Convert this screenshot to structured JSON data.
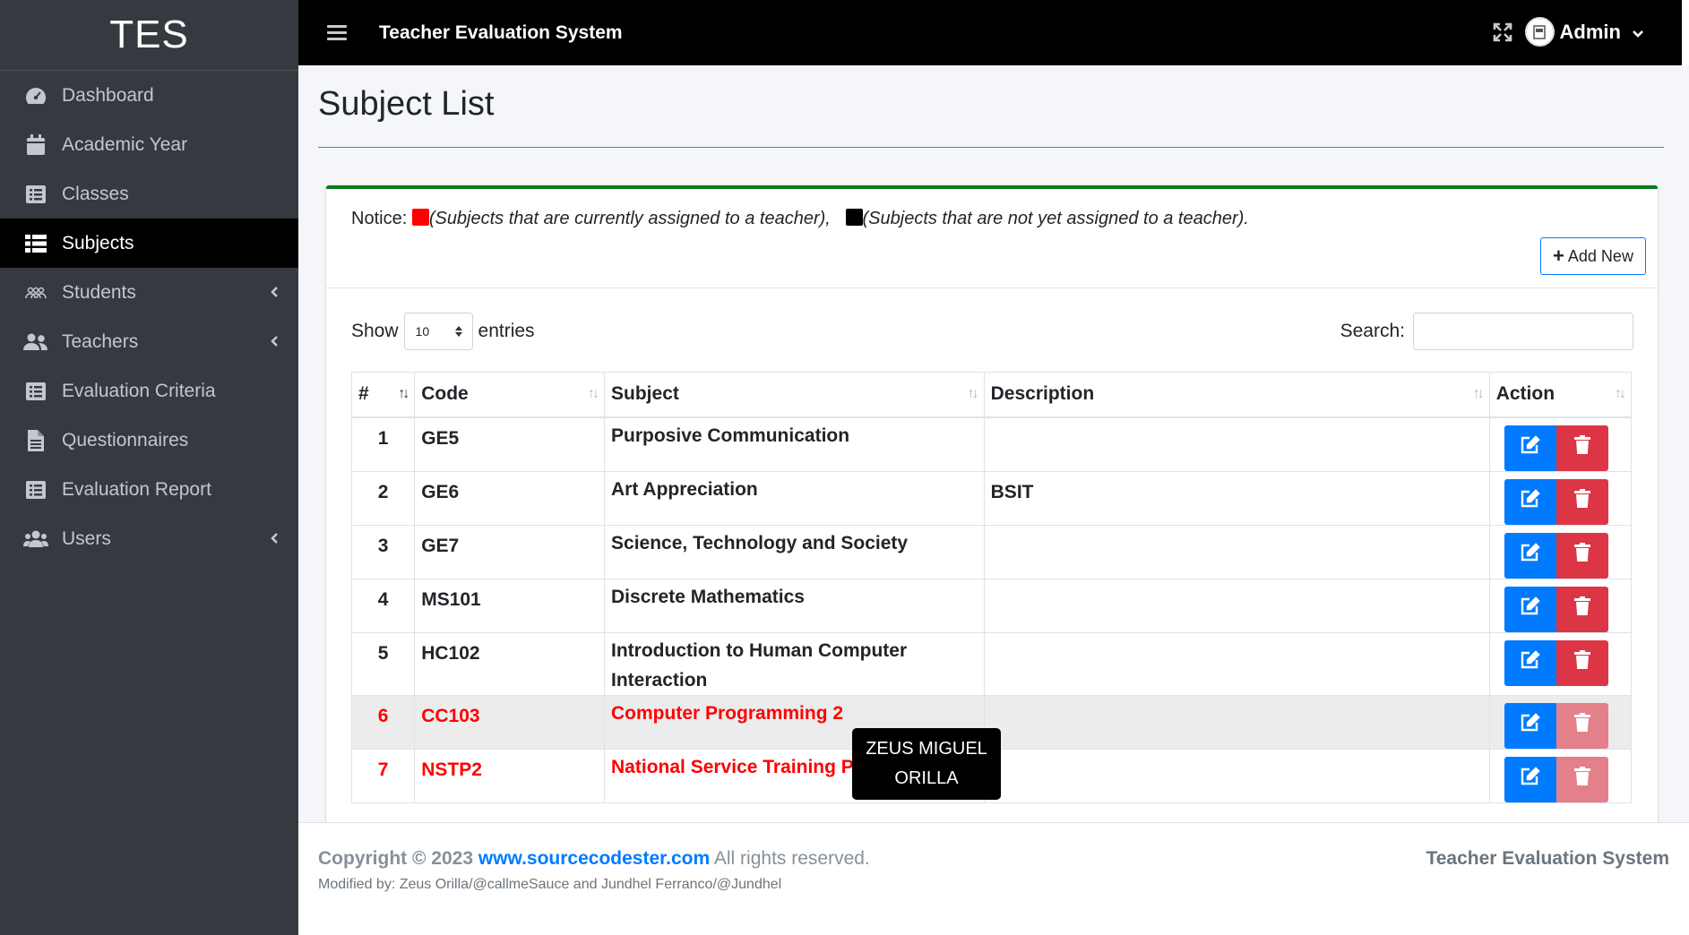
{
  "sidebar": {
    "brand": "TES",
    "items": [
      {
        "label": "Dashboard",
        "icon": "tachometer-icon",
        "active": false,
        "has_children": false
      },
      {
        "label": "Academic Year",
        "icon": "calendar-icon",
        "active": false,
        "has_children": false
      },
      {
        "label": "Classes",
        "icon": "list-alt-icon",
        "active": false,
        "has_children": false
      },
      {
        "label": "Subjects",
        "icon": "th-list-icon",
        "active": true,
        "has_children": false
      },
      {
        "label": "Students",
        "icon": "users-outline-icon",
        "active": false,
        "has_children": true
      },
      {
        "label": "Teachers",
        "icon": "user-friends-icon",
        "active": false,
        "has_children": true
      },
      {
        "label": "Evaluation Criteria",
        "icon": "list-alt-icon",
        "active": false,
        "has_children": false
      },
      {
        "label": "Questionnaires",
        "icon": "file-alt-icon",
        "active": false,
        "has_children": false
      },
      {
        "label": "Evaluation Report",
        "icon": "list-alt-icon",
        "active": false,
        "has_children": false
      },
      {
        "label": "Users",
        "icon": "users-icon",
        "active": false,
        "has_children": true
      }
    ]
  },
  "topbar": {
    "title": "Teacher Evaluation System",
    "user_name": "Admin"
  },
  "page": {
    "title": "Subject List"
  },
  "card": {
    "notice_label": "Notice:",
    "notice_assigned": "(Subjects that are currently assigned to a teacher),",
    "notice_unassigned": "(Subjects that are not yet assigned to a teacher).",
    "add_new_label": "Add New",
    "show_label": "Show",
    "entries_value": "10",
    "entries_label": "entries",
    "search_label": "Search:",
    "search_value": ""
  },
  "table": {
    "headers": [
      "#",
      "Code",
      "Subject",
      "Description",
      "Action"
    ],
    "rows": [
      {
        "num": "1",
        "code": "GE5",
        "subject": "Purposive Communication",
        "description": "",
        "assigned": false
      },
      {
        "num": "2",
        "code": "GE6",
        "subject": "Art Appreciation",
        "description": "BSIT",
        "assigned": false
      },
      {
        "num": "3",
        "code": "GE7",
        "subject": "Science, Technology and Society",
        "description": "",
        "assigned": false
      },
      {
        "num": "4",
        "code": "MS101",
        "subject": "Discrete Mathematics",
        "description": "",
        "assigned": false
      },
      {
        "num": "5",
        "code": "HC102",
        "subject": "Introduction to Human Computer Interaction",
        "description": "",
        "assigned": false
      },
      {
        "num": "6",
        "code": "CC103",
        "subject": "Computer Programming 2",
        "description": "",
        "assigned": true
      },
      {
        "num": "7",
        "code": "NSTP2",
        "subject": "National Service Training Program",
        "description": "",
        "assigned": true
      }
    ]
  },
  "tooltip": {
    "text": "ZEUS MIGUEL ORILLA"
  },
  "footer": {
    "copyright": "Copyright © 2023",
    "link": "www.sourcecodester.com",
    "rights": "All rights reserved.",
    "modified": "Modified by: Zeus Orilla/@callmeSauce and Jundhel Ferranco/@Jundhel",
    "right_text": "Teacher Evaluation System"
  },
  "colors": {
    "sidebar_bg": "#343a40",
    "topbar_bg": "#000000",
    "assigned_color": "#ff0000",
    "unassigned_color": "#000000",
    "edit_button": "#007bff",
    "delete_button": "#dc3545"
  }
}
